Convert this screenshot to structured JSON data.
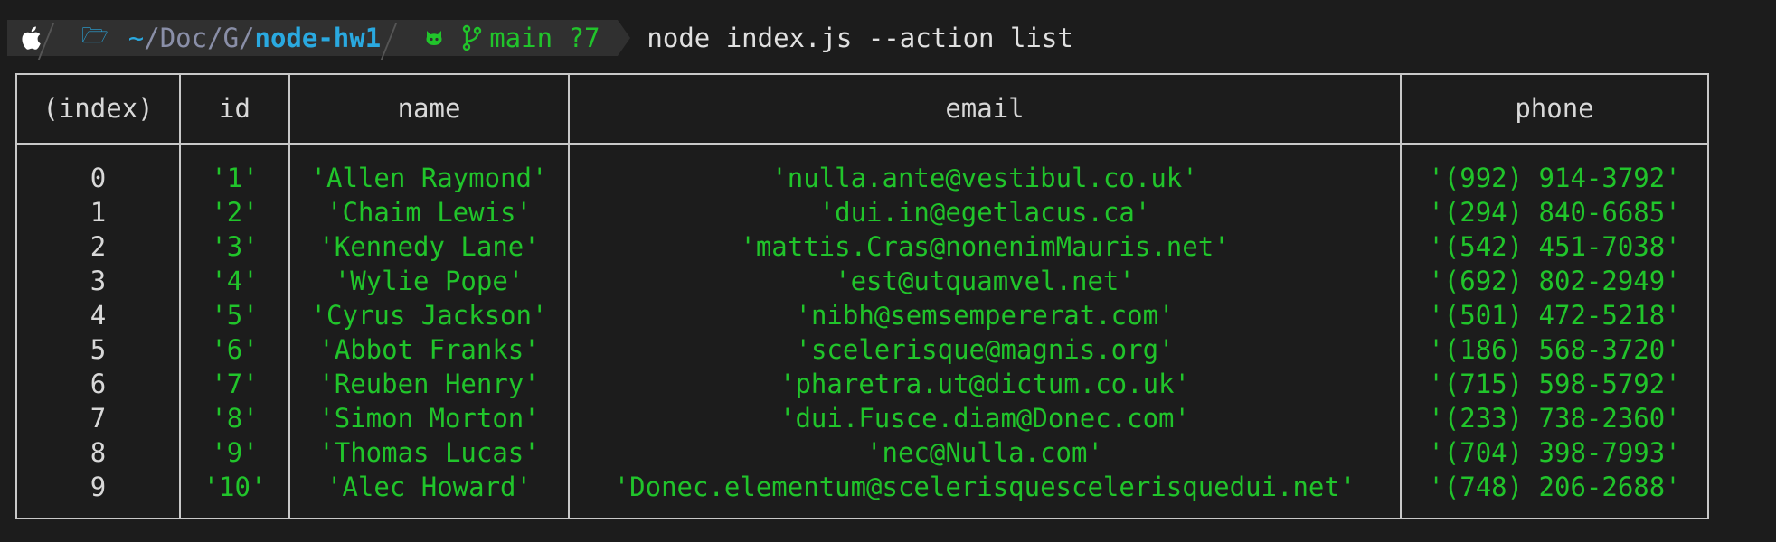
{
  "prompt": {
    "apple_icon": "apple-logo-icon",
    "folder_icon": "folder-open-icon",
    "path_prefix_tilde": "~",
    "path_sep": "/",
    "path_doc": "Doc",
    "path_g": "G",
    "path_current": "node-hw1",
    "git_icon": "github-cat-icon",
    "branch_icon": "git-branch-icon",
    "branch": "main ?7",
    "command": "node index.js --action list"
  },
  "colors": {
    "background": "#1c1c1c",
    "segment": "#303030",
    "path_blue": "#2aa9e0",
    "path_dim": "#8a8fa8",
    "value_green": "#21c42b",
    "text": "#d8d8d8"
  },
  "table": {
    "headers": [
      "(index)",
      "id",
      "name",
      "email",
      "phone"
    ],
    "rows": [
      {
        "index": "0",
        "id": "'1'",
        "name": "'Allen Raymond'",
        "email": "'nulla.ante@vestibul.co.uk'",
        "phone": "'(992) 914-3792'"
      },
      {
        "index": "1",
        "id": "'2'",
        "name": "'Chaim Lewis'",
        "email": "'dui.in@egetlacus.ca'",
        "phone": "'(294) 840-6685'"
      },
      {
        "index": "2",
        "id": "'3'",
        "name": "'Kennedy Lane'",
        "email": "'mattis.Cras@nonenimMauris.net'",
        "phone": "'(542) 451-7038'"
      },
      {
        "index": "3",
        "id": "'4'",
        "name": "'Wylie Pope'",
        "email": "'est@utquamvel.net'",
        "phone": "'(692) 802-2949'"
      },
      {
        "index": "4",
        "id": "'5'",
        "name": "'Cyrus Jackson'",
        "email": "'nibh@semsempererat.com'",
        "phone": "'(501) 472-5218'"
      },
      {
        "index": "5",
        "id": "'6'",
        "name": "'Abbot Franks'",
        "email": "'scelerisque@magnis.org'",
        "phone": "'(186) 568-3720'"
      },
      {
        "index": "6",
        "id": "'7'",
        "name": "'Reuben Henry'",
        "email": "'pharetra.ut@dictum.co.uk'",
        "phone": "'(715) 598-5792'"
      },
      {
        "index": "7",
        "id": "'8'",
        "name": "'Simon Morton'",
        "email": "'dui.Fusce.diam@Donec.com'",
        "phone": "'(233) 738-2360'"
      },
      {
        "index": "8",
        "id": "'9'",
        "name": "'Thomas Lucas'",
        "email": "'nec@Nulla.com'",
        "phone": "'(704) 398-7993'"
      },
      {
        "index": "9",
        "id": "'10'",
        "name": "'Alec Howard'",
        "email": "'Donec.elementum@scelerisquescelerisquedui.net'",
        "phone": "'(748) 206-2688'"
      }
    ]
  }
}
